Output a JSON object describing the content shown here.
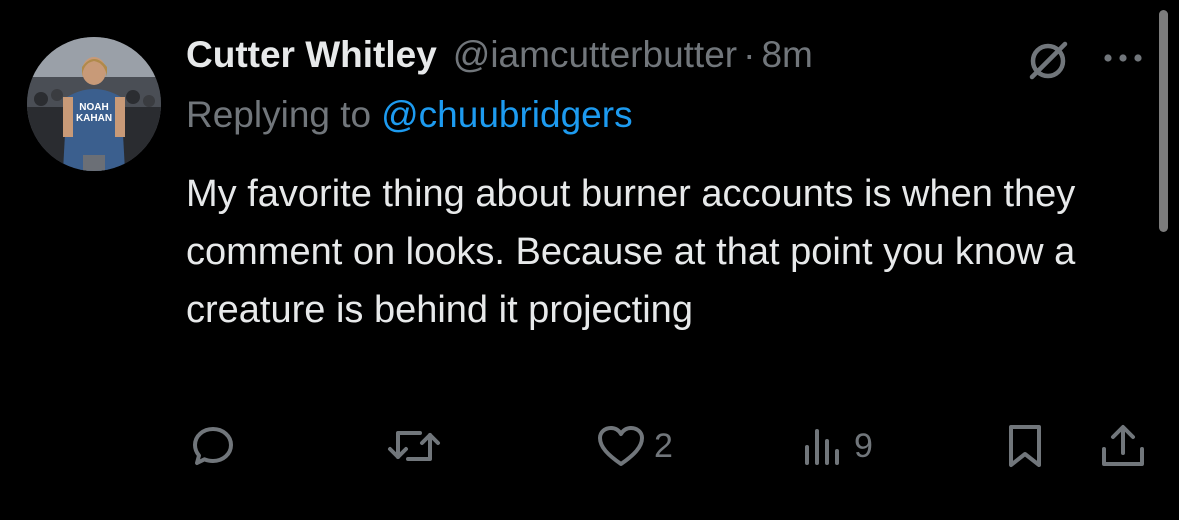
{
  "tweet": {
    "author": {
      "display_name": "Cutter Whitley",
      "handle": "@iamcutterbutter",
      "separator": "·",
      "time": "8m",
      "avatar_shirt_text": [
        "NOAH",
        "KAHAN"
      ]
    },
    "replying": {
      "label": "Replying to",
      "handle": "@chuubridgers"
    },
    "text": "My favorite thing about burner accounts is when they comment on looks. Because at that point you know a creature is behind it projecting",
    "header_icons": {
      "grok": "grok-icon",
      "more": "more-icon"
    },
    "actions": {
      "reply": {
        "icon": "reply-icon",
        "count": ""
      },
      "repost": {
        "icon": "repost-icon",
        "count": ""
      },
      "like": {
        "icon": "heart-icon",
        "count": "2"
      },
      "views": {
        "icon": "views-icon",
        "count": "9"
      },
      "bookmark": {
        "icon": "bookmark-icon",
        "count": ""
      },
      "share": {
        "icon": "share-icon",
        "count": ""
      }
    }
  },
  "colors": {
    "background": "#000000",
    "text_primary": "#e7e9ea",
    "text_secondary": "#71767b",
    "link": "#1d9bf0"
  }
}
